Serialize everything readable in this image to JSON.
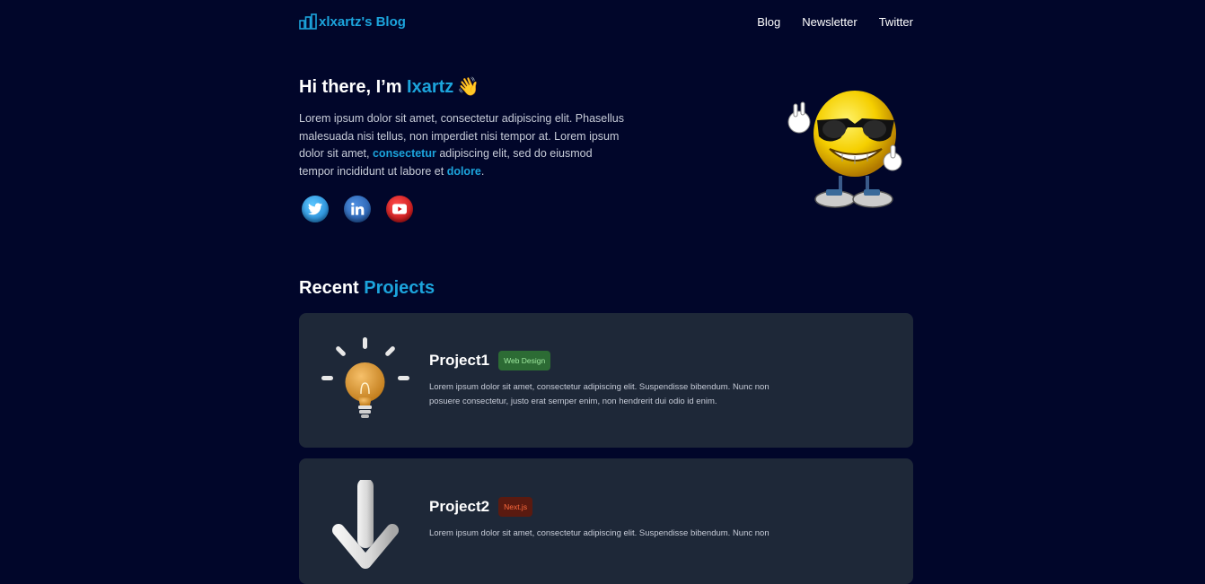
{
  "nav": {
    "brand": "xlxartz's Blog",
    "links": [
      "Blog",
      "Newsletter",
      "Twitter"
    ]
  },
  "hero": {
    "greeting": "Hi there, I’m ",
    "name": "Ixartz",
    "wave_emoji": "👋",
    "bio_1": "Lorem ipsum dolor sit amet, consectetur adipiscing elit. Phasellus malesuada nisi tellus, non imperdiet nisi tempor at. Lorem ipsum dolor sit amet, ",
    "bio_link_1": "consectetur",
    "bio_2": " adipiscing elit, sed do eiusmod tempor incididunt ut labore et ",
    "bio_link_2": "dolore",
    "bio_3": ".",
    "socials": [
      "twitter-icon",
      "linkedin-icon",
      "youtube-icon"
    ]
  },
  "projects": {
    "title_prefix": "Recent ",
    "title_accent": "Projects",
    "items": [
      {
        "name": "Project1",
        "tag": "Web Design",
        "tag_color": "#2c6b34",
        "icon": "lightbulb-icon",
        "description": "Lorem ipsum dolor sit amet, consectetur adipiscing elit. Suspendisse bibendum. Nunc non posuere consectetur, justo erat semper enim, non hendrerit dui odio id enim."
      },
      {
        "name": "Project2",
        "tag": "Next.js",
        "tag_color": "#5a1a10",
        "icon": "arrow-down-icon",
        "description": "Lorem ipsum dolor sit amet, consectetur adipiscing elit. Suspendisse bibendum. Nunc non"
      }
    ]
  },
  "colors": {
    "background": "#01062a",
    "accent": "#1ca4dc",
    "card": "#1e2838"
  }
}
